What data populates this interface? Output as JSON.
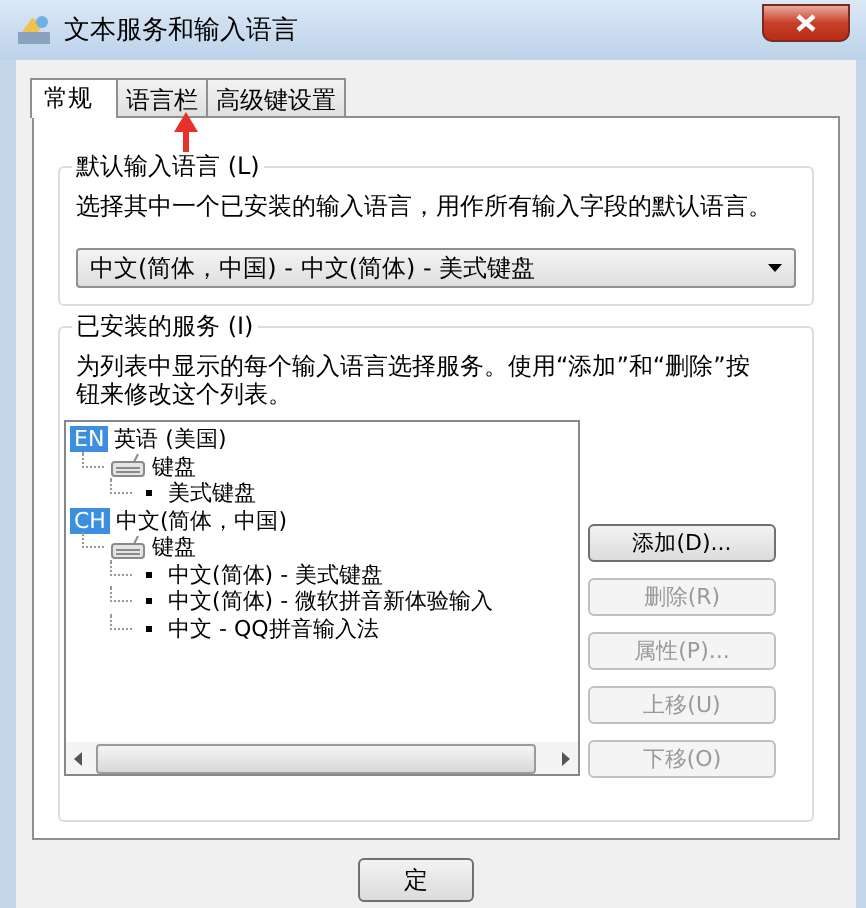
{
  "window": {
    "title": "文本服务和输入语言"
  },
  "tabs": [
    {
      "label": "常规",
      "selected": true
    },
    {
      "label": "语言栏",
      "selected": false
    },
    {
      "label": "高级键设置",
      "selected": false
    }
  ],
  "default_language": {
    "title": "默认输入语言 (L)",
    "description": "选择其中一个已安装的输入语言，用作所有输入字段的默认语言。",
    "value": "中文(简体，中国) - 中文(简体) - 美式键盘"
  },
  "installed_services": {
    "title": "已安装的服务 (I)",
    "description": "为列表中显示的每个输入语言选择服务。使用“添加”和“删除”按钮来修改这个列表。",
    "tree": [
      {
        "kind": "language",
        "badge": "EN",
        "label": "英语 (美国)",
        "children": [
          {
            "kind": "category",
            "label": "键盘",
            "children": [
              {
                "kind": "service",
                "label": "美式键盘"
              }
            ]
          }
        ]
      },
      {
        "kind": "language",
        "badge": "CH",
        "label": "中文(简体，中国)",
        "children": [
          {
            "kind": "category",
            "label": "键盘",
            "children": [
              {
                "kind": "service",
                "label": "中文(简体) - 美式键盘"
              },
              {
                "kind": "service",
                "label": "中文(简体) - 微软拼音新体验输入"
              },
              {
                "kind": "service",
                "label": "中文 - QQ拼音输入法"
              }
            ]
          }
        ]
      }
    ],
    "buttons": [
      {
        "label": "添加(D)...",
        "disabled": false
      },
      {
        "label": "删除(R)",
        "disabled": true
      },
      {
        "label": "属性(P)...",
        "disabled": true
      },
      {
        "label": "上移(U)",
        "disabled": true
      },
      {
        "label": "下移(O)",
        "disabled": true
      }
    ]
  },
  "footer_buttons": [
    {
      "label": "定"
    }
  ]
}
